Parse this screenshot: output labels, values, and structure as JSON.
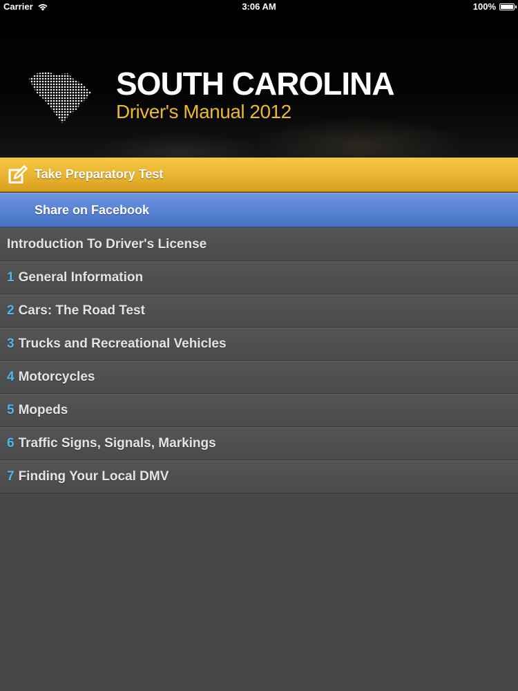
{
  "status_bar": {
    "carrier": "Carrier",
    "time": "3:06 AM",
    "battery": "100%"
  },
  "banner": {
    "title": "SOUTH CAROLINA",
    "subtitle": "Driver's Manual 2012",
    "icon": "south-carolina-map-icon",
    "subtitle_color": "#e8b92c"
  },
  "actions": {
    "test_label": "Take Preparatory Test",
    "test_icon": "edit-icon",
    "test_color": "#eab533",
    "facebook_label": "Share on Facebook",
    "facebook_color": "#5882d4"
  },
  "chapters": {
    "intro": "Introduction To Driver's License",
    "items": [
      {
        "num": "1",
        "label": "General Information"
      },
      {
        "num": "2",
        "label": "Cars: The Road Test"
      },
      {
        "num": "3",
        "label": "Trucks and Recreational Vehicles"
      },
      {
        "num": "4",
        "label": "Motorcycles"
      },
      {
        "num": "5",
        "label": "Mopeds"
      },
      {
        "num": "6",
        "label": "Traffic Signs, Signals, Markings"
      },
      {
        "num": "7",
        "label": "Finding Your Local DMV"
      }
    ],
    "number_color": "#4fb6ee"
  }
}
